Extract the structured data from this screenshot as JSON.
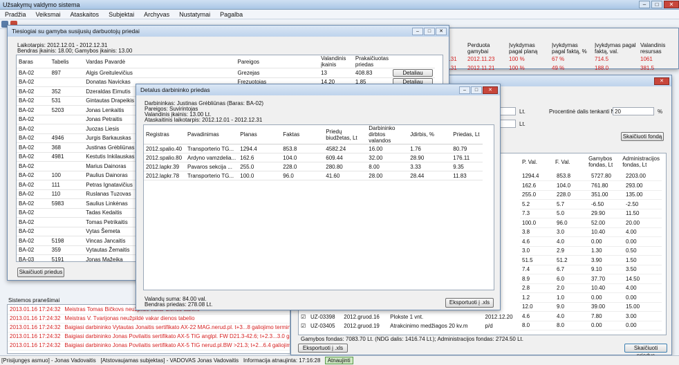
{
  "app": {
    "title": "Užsakymų valdymo sistema",
    "menu": [
      "Pradžia",
      "Veiksmai",
      "Ataskaitos",
      "Subjektai",
      "Archyvas",
      "Nustatymai",
      "Pagalba"
    ]
  },
  "status": {
    "user": "[Prisijungęs asmuo] - Jonas Vadovaitis",
    "subject": "[Atstovaujamas subjektas] - VADOVAS Jonas Vadovaitis",
    "updated": "Informacija atnaujinta: 17:16:28",
    "update_btn": "Atnaujinti"
  },
  "log": {
    "title": "Sistemos pranešimai",
    "rows": [
      {
        "time": "2013.01.16 17:24:32",
        "msg": "Meistras Tomas Bičkovs neužpildė vakar dienos tabelio"
      },
      {
        "time": "2013.01.16 17:24:32",
        "msg": "Meistras V. Tvarijonas neužpildė vakar dienos tabelio"
      },
      {
        "time": "2013.01.16 17:24:32",
        "msg": "Baigiasi darbininko Vytautas Jonaitis sertifikato AX-22 MAG.nerud.pl. t+3...8 galiojimo terminas. Galioja iki: 2011.11"
      },
      {
        "time": "2013.01.16 17:24:32",
        "msg": "Baigiasi darbininko Jonas Povilaitis sertifikato AX-5 TIG anglpl. FW D21.3-42.6; t+2.3...3.0 galiojimo terminas. Galioja iki:"
      },
      {
        "time": "2013.01.16 17:24:32",
        "msg": "Baigiasi darbininko Jonas Povilaitis sertifikato AX-5 TIG nerud.pl.BW >21.3; t+2...6.4 galiojimo terminas. Galioja iki:"
      }
    ]
  },
  "w1": {
    "title": "Tiesiogiai su gamyba susijusių darbuotojų priedai",
    "period": "Laikotarpis: 2012.12.01 - 2012.12.31",
    "total": "Bendras įkainis: 18.00; Gamybos įkainis: 13.00",
    "cols": [
      "Baras",
      "Tabelis",
      "Vardas Pavardė",
      "Pareigos",
      "Valandinis įkainis",
      "Prakaičiuotas priedas"
    ],
    "rows": [
      [
        "BA-02",
        "897",
        "Algis Greituleviči­us",
        "Grezejas",
        "13",
        "408.83"
      ],
      [
        "BA-02",
        "",
        "Donatas Navickas",
        "Frezuotojas",
        "14.20",
        "1.85"
      ],
      [
        "BA-02",
        "352",
        "Dzeraldas Eimutis",
        "",
        "",
        ""
      ],
      [
        "BA-02",
        "531",
        "Gintautas Drapeikis",
        "",
        "",
        ""
      ],
      [
        "BA-02",
        "5203",
        "Jonas Lenkaitis",
        "",
        "",
        ""
      ],
      [
        "BA-02",
        "",
        "Jonas Petraitis",
        "",
        "",
        ""
      ],
      [
        "BA-02",
        "",
        "Juozas Liesis",
        "",
        "",
        ""
      ],
      [
        "BA-02",
        "4946",
        "Jurgis Barkauskas",
        "",
        "",
        ""
      ],
      [
        "BA-02",
        "368",
        "Justinas Grėbliūnas",
        "",
        "",
        ""
      ],
      [
        "BA-02",
        "4981",
        "Kestutis Inkilauskas",
        "",
        "",
        ""
      ],
      [
        "BA-02",
        "",
        "Marius Dainoras",
        "",
        "",
        ""
      ],
      [
        "BA-02",
        "100",
        "Paulius Dainoras",
        "",
        "",
        ""
      ],
      [
        "BA-02",
        "111",
        "Petras Ignataviči­us",
        "",
        "",
        ""
      ],
      [
        "BA-02",
        "110",
        "Ruslanas Tuzovas",
        "",
        "",
        ""
      ],
      [
        "BA-02",
        "5983",
        "Saulius Linkėnas",
        "",
        "",
        ""
      ],
      [
        "BA-02",
        "",
        "Tadas Kedaitis",
        "",
        "",
        ""
      ],
      [
        "BA-02",
        "",
        "Tomas Petrikaitis",
        "",
        "",
        ""
      ],
      [
        "BA-02",
        "",
        "Vytas Šemeta",
        "",
        "",
        ""
      ],
      [
        "BA-02",
        "5198",
        "Vincas Jancaitis",
        "",
        "",
        ""
      ],
      [
        "BA-02",
        "359",
        "Vytautas Žemaitis",
        "",
        "",
        ""
      ],
      [
        "BA-03",
        "5191",
        "Jonas Mažeika",
        "",
        "",
        ""
      ]
    ],
    "detail_btn": "Detaliau",
    "calc_btn": "Skaičiuoti priedus"
  },
  "bg": {
    "top_cols": [
      "mo",
      "Perduota gamybai",
      "Įvykdymas pagal planą",
      "Įvykdymas pagal faktą, %",
      "Įvykdymas pagal faktą, val.",
      "Valandinis resursas"
    ],
    "top_rows": [
      [
        "2.12.31",
        "2012.11.23",
        "100 %",
        "67 %",
        "714.5",
        "1061"
      ],
      [
        "2.12.31",
        "2012.11.21",
        "100 %",
        "49 %",
        "188.0",
        "381.5"
      ]
    ]
  },
  "w3": {
    "lt1": "Lt.",
    "lt2": "Lt.",
    "pct_label": "Procentinė dalis tenkanti NG:",
    "pct_value": "20",
    "pct_unit": "%",
    "calc_fund_btn": "Skaičiuoti fondą",
    "cols": [
      "P. Val.",
      "F. Val.",
      "Gamybos fondas, Lt",
      "Administracijos fondas, Lt"
    ],
    "rows": [
      [
        "1294.4",
        "853.8",
        "5727.80",
        "2203.00"
      ],
      [
        "162.6",
        "104.0",
        "761.80",
        "293.00"
      ],
      [
        "255.0",
        "228.0",
        "351.00",
        "135.00"
      ],
      [
        "5.2",
        "5.7",
        "-6.50",
        "-2.50"
      ],
      [
        "7.3",
        "5.0",
        "29.90",
        "11.50"
      ],
      [
        "100.0",
        "96.0",
        "52.00",
        "20.00"
      ],
      [
        "3.8",
        "3.0",
        "10.40",
        "4.00"
      ],
      [
        "4.6",
        "4.0",
        "0.00",
        "0.00"
      ],
      [
        "3.0",
        "2.9",
        "1.30",
        "0.50"
      ],
      [
        "51.5",
        "51.2",
        "3.90",
        "1.50"
      ],
      [
        "7.4",
        "6.7",
        "9.10",
        "3.50"
      ],
      [
        "8.9",
        "6.0",
        "37.70",
        "14.50"
      ],
      [
        "2.8",
        "2.0",
        "10.40",
        "4.00"
      ],
      [
        "1.2",
        "1.0",
        "0.00",
        "0.00"
      ],
      [
        "12.0",
        "9.0",
        "39.00",
        "15.00"
      ],
      [
        "4.6",
        "4.0",
        "7.80",
        "3.00"
      ],
      [
        "8.0",
        "8.0",
        "0.00",
        "0.00"
      ]
    ],
    "left_rows": [
      [
        "UZ-03398",
        "2012.gruod.16",
        "Plokste 1 vnt.",
        "2012.12.20"
      ],
      [
        "UZ-03405",
        "2012.gruod.19",
        "Atrakcinimo medžiagos 20 kv.m",
        "p/d"
      ]
    ],
    "summary": "Gamybos fondas: 7083.70 Lt. (NDG dalis: 1416.74 Lt.); Administracijos fondas: 2724.50 Lt.",
    "export_btn": "Eksportuoti į .xls",
    "calc_bonus_btn": "Skaičiuoti priedus"
  },
  "w2": {
    "title": "Detalus darbininko priedas",
    "worker": "Darbininkas: Justinas Grėbliūnas (Baras: BA-02)",
    "position": "Pareigos: Suvirintojas",
    "rate": "Valandinis įkainis: 13.00 Lt.",
    "period": "Ataskaitinis laikotarpis: 2012.12.01 - 2012.12.31",
    "cols": [
      "Registras",
      "Pavadinimas",
      "Planas",
      "Faktas",
      "Priedų biudžetas, Lt",
      "Darbininko dirbtos valandos",
      "Jdirbis, %",
      "Priedas, Lt"
    ],
    "rows": [
      [
        "2012.spalio.40",
        "Transporterio TG...",
        "1294.4",
        "853.8",
        "4582.24",
        "16.00",
        "1.76",
        "80.79"
      ],
      [
        "2012.spalio.80",
        "Ardyno vamzdelia...",
        "162.6",
        "104.0",
        "609.44",
        "32.00",
        "28.90",
        "176.11"
      ],
      [
        "2012.lapkr.39",
        "Pavaros sekcija ...",
        "255.0",
        "228.0",
        "280.80",
        "8.00",
        "3.33",
        "9.35"
      ],
      [
        "2012.lapkr.78",
        "Transporterio TG...",
        "100.0",
        "96.0",
        "41.60",
        "28.00",
        "28.44",
        "11.83"
      ]
    ],
    "hours": "Valandų suma: 84.00 val.",
    "total": "Bendras priedas: 278.08 Lt.",
    "export_btn": "Eksportuoti į .xls"
  }
}
